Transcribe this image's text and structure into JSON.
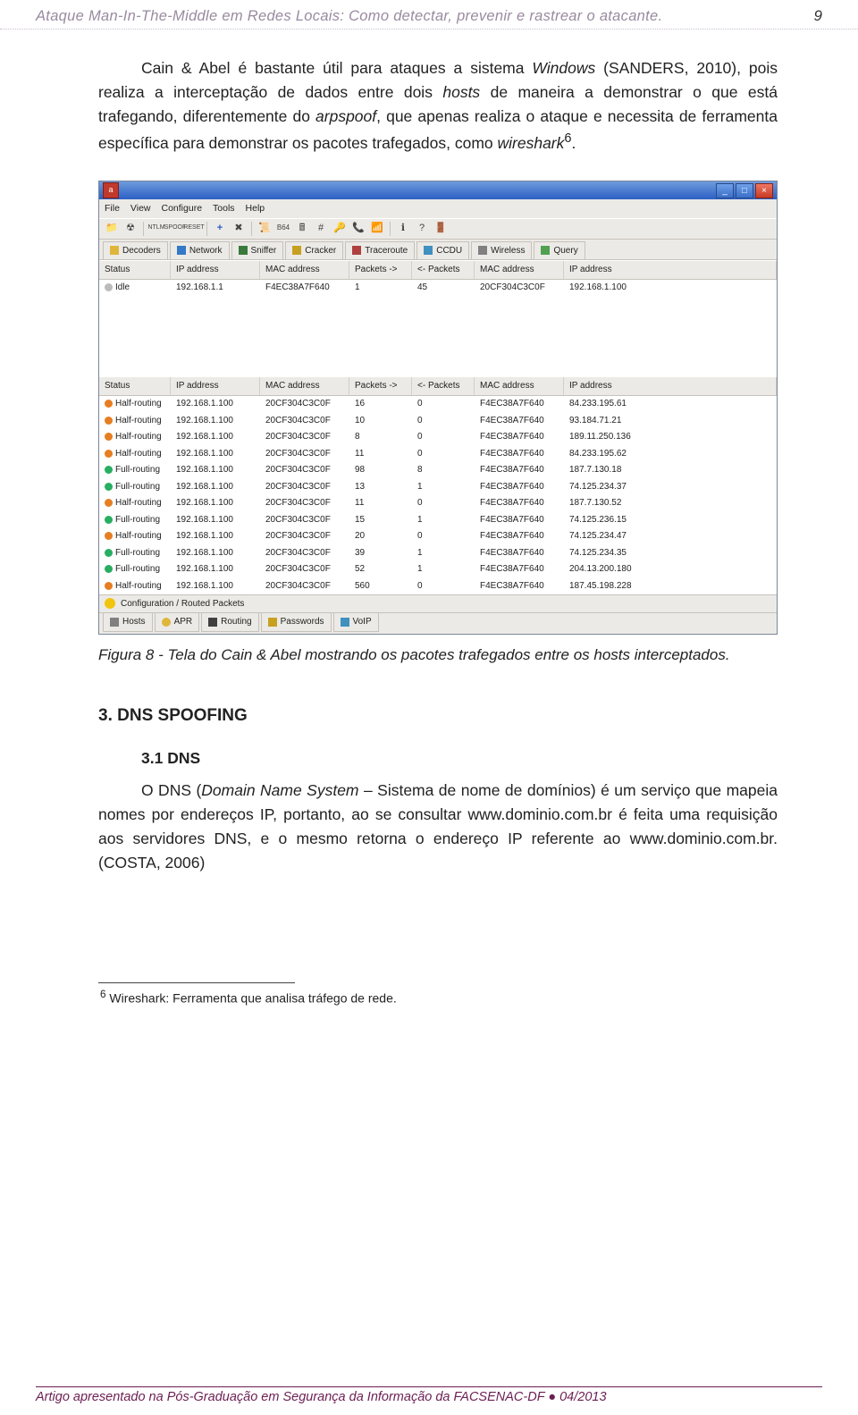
{
  "header": {
    "title": "Ataque Man-In-The-Middle em Redes Locais: Como detectar, prevenir e rastrear o atacante.",
    "page_number": "9"
  },
  "body": {
    "p1_pre": "Cain & Abel é bastante útil para ataques a sistema ",
    "p1_it1": "Windows",
    "p1_mid1": " (SANDERS, 2010), pois realiza a interceptação de dados entre dois ",
    "p1_it2": "hosts",
    "p1_mid2": " de maneira a demonstrar o que está trafegando, diferentemente do ",
    "p1_it3": "arpspoof",
    "p1_mid3": ", que apenas realiza o ataque e necessita de ferramenta específica para demonstrar os pacotes trafegados, como ",
    "p1_it4": "wireshark",
    "p1_sup": "6",
    "p1_end": "."
  },
  "app": {
    "menubar": [
      "File",
      "View",
      "Configure",
      "Tools",
      "Help"
    ],
    "tabs_top": [
      "Decoders",
      "Network",
      "Sniffer",
      "Cracker",
      "Traceroute",
      "CCDU",
      "Wireless",
      "Query"
    ],
    "grid_headers": [
      "Status",
      "IP address",
      "MAC address",
      "Packets ->",
      "<- Packets",
      "MAC address",
      "IP address"
    ],
    "top_rows": [
      {
        "status": "Idle",
        "cls": "idle",
        "ip": "192.168.1.1",
        "mac": "F4EC38A7F640",
        "pout": "1",
        "pin": "45",
        "mac2": "20CF304C3C0F",
        "ip2": "192.168.1.100"
      }
    ],
    "bottom_rows": [
      {
        "status": "Half-routing",
        "cls": "half",
        "ip": "192.168.1.100",
        "mac": "20CF304C3C0F",
        "pout": "16",
        "pin": "0",
        "mac2": "F4EC38A7F640",
        "ip2": "84.233.195.61"
      },
      {
        "status": "Half-routing",
        "cls": "half",
        "ip": "192.168.1.100",
        "mac": "20CF304C3C0F",
        "pout": "10",
        "pin": "0",
        "mac2": "F4EC38A7F640",
        "ip2": "93.184.71.21"
      },
      {
        "status": "Half-routing",
        "cls": "half",
        "ip": "192.168.1.100",
        "mac": "20CF304C3C0F",
        "pout": "8",
        "pin": "0",
        "mac2": "F4EC38A7F640",
        "ip2": "189.11.250.136"
      },
      {
        "status": "Half-routing",
        "cls": "half",
        "ip": "192.168.1.100",
        "mac": "20CF304C3C0F",
        "pout": "11",
        "pin": "0",
        "mac2": "F4EC38A7F640",
        "ip2": "84.233.195.62"
      },
      {
        "status": "Full-routing",
        "cls": "full",
        "ip": "192.168.1.100",
        "mac": "20CF304C3C0F",
        "pout": "98",
        "pin": "8",
        "mac2": "F4EC38A7F640",
        "ip2": "187.7.130.18"
      },
      {
        "status": "Full-routing",
        "cls": "full",
        "ip": "192.168.1.100",
        "mac": "20CF304C3C0F",
        "pout": "13",
        "pin": "1",
        "mac2": "F4EC38A7F640",
        "ip2": "74.125.234.37"
      },
      {
        "status": "Half-routing",
        "cls": "half",
        "ip": "192.168.1.100",
        "mac": "20CF304C3C0F",
        "pout": "11",
        "pin": "0",
        "mac2": "F4EC38A7F640",
        "ip2": "187.7.130.52"
      },
      {
        "status": "Full-routing",
        "cls": "full",
        "ip": "192.168.1.100",
        "mac": "20CF304C3C0F",
        "pout": "15",
        "pin": "1",
        "mac2": "F4EC38A7F640",
        "ip2": "74.125.236.15"
      },
      {
        "status": "Half-routing",
        "cls": "half",
        "ip": "192.168.1.100",
        "mac": "20CF304C3C0F",
        "pout": "20",
        "pin": "0",
        "mac2": "F4EC38A7F640",
        "ip2": "74.125.234.47"
      },
      {
        "status": "Full-routing",
        "cls": "full",
        "ip": "192.168.1.100",
        "mac": "20CF304C3C0F",
        "pout": "39",
        "pin": "1",
        "mac2": "F4EC38A7F640",
        "ip2": "74.125.234.35"
      },
      {
        "status": "Full-routing",
        "cls": "full",
        "ip": "192.168.1.100",
        "mac": "20CF304C3C0F",
        "pout": "52",
        "pin": "1",
        "mac2": "F4EC38A7F640",
        "ip2": "204.13.200.180"
      },
      {
        "status": "Half-routing",
        "cls": "half",
        "ip": "192.168.1.100",
        "mac": "20CF304C3C0F",
        "pout": "560",
        "pin": "0",
        "mac2": "F4EC38A7F640",
        "ip2": "187.45.198.228"
      }
    ],
    "conf_tab": "Configuration / Routed Packets",
    "tabs_bottom": [
      "Hosts",
      "APR",
      "Routing",
      "Passwords",
      "VoIP"
    ]
  },
  "caption": "Figura 8 - Tela do Cain & Abel mostrando os pacotes trafegados entre os hosts interceptados.",
  "section": {
    "h2": "3. DNS SPOOFING",
    "h3": "3.1 DNS",
    "p2_pre": "O DNS (",
    "p2_it1": "Domain Name System",
    "p2_mid1": " – Sistema de nome de domínios) é um serviço que mapeia nomes por endereços IP, portanto, ao se consultar www.dominio.com.br é feita uma requisição aos servidores DNS, e o mesmo retorna o endereço IP referente ao www.dominio.com.br. (COSTA, 2006)"
  },
  "footnote": {
    "marker": "6",
    "text": " Wireshark: Ferramenta que analisa tráfego de rede."
  },
  "footer": "Artigo apresentado na Pós-Graduação em Segurança da Informação da FACSENAC-DF ● 04/2013"
}
